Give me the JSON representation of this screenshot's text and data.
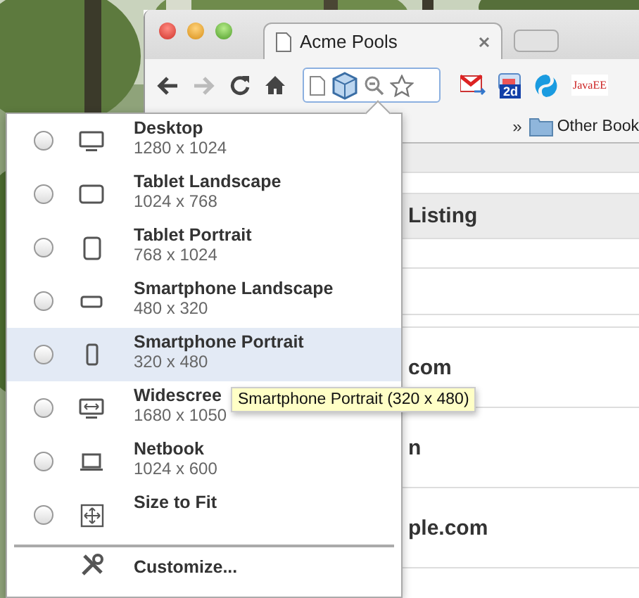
{
  "browser": {
    "tab": {
      "title": "Acme Pools"
    },
    "toolbar": {
      "extensions": [
        {
          "kind": "mail"
        },
        {
          "kind": "calendar",
          "text": "2d"
        },
        {
          "kind": "swirl"
        },
        {
          "kind": "logo",
          "text": "JavaEE"
        }
      ]
    },
    "bookmarks_bar": {
      "overflow": "»",
      "folder": "Other Book"
    }
  },
  "page": {
    "header": "Listing",
    "rows": [
      "com",
      "n",
      "ple.com"
    ]
  },
  "menu": {
    "items": [
      {
        "kind": "monitor",
        "label": "Desktop",
        "size": "1280 x 1024",
        "selected": false,
        "hovered": false
      },
      {
        "kind": "tabletwide",
        "label": "Tablet Landscape",
        "size": "1024 x 768",
        "selected": false,
        "hovered": false
      },
      {
        "kind": "tablet",
        "label": "Tablet Portrait",
        "size": "768 x 1024",
        "selected": false,
        "hovered": false
      },
      {
        "kind": "phonewide",
        "label": "Smartphone Landscape",
        "size": "480 x 320",
        "selected": false,
        "hovered": false
      },
      {
        "kind": "phone",
        "label": "Smartphone Portrait",
        "size": "320 x 480",
        "selected": false,
        "hovered": true
      },
      {
        "kind": "widescreen",
        "label": "Widescree",
        "size": "1680 x 1050",
        "selected": false,
        "hovered": false
      },
      {
        "kind": "laptop",
        "label": "Netbook",
        "size": "1024 x 600",
        "selected": false,
        "hovered": false
      },
      {
        "kind": "fit",
        "label": "Size to Fit",
        "selected": false,
        "hovered": false
      }
    ],
    "customize": {
      "label": "Customize..."
    }
  },
  "tooltip": {
    "text": "Smartphone Portrait (320 x 480)"
  }
}
